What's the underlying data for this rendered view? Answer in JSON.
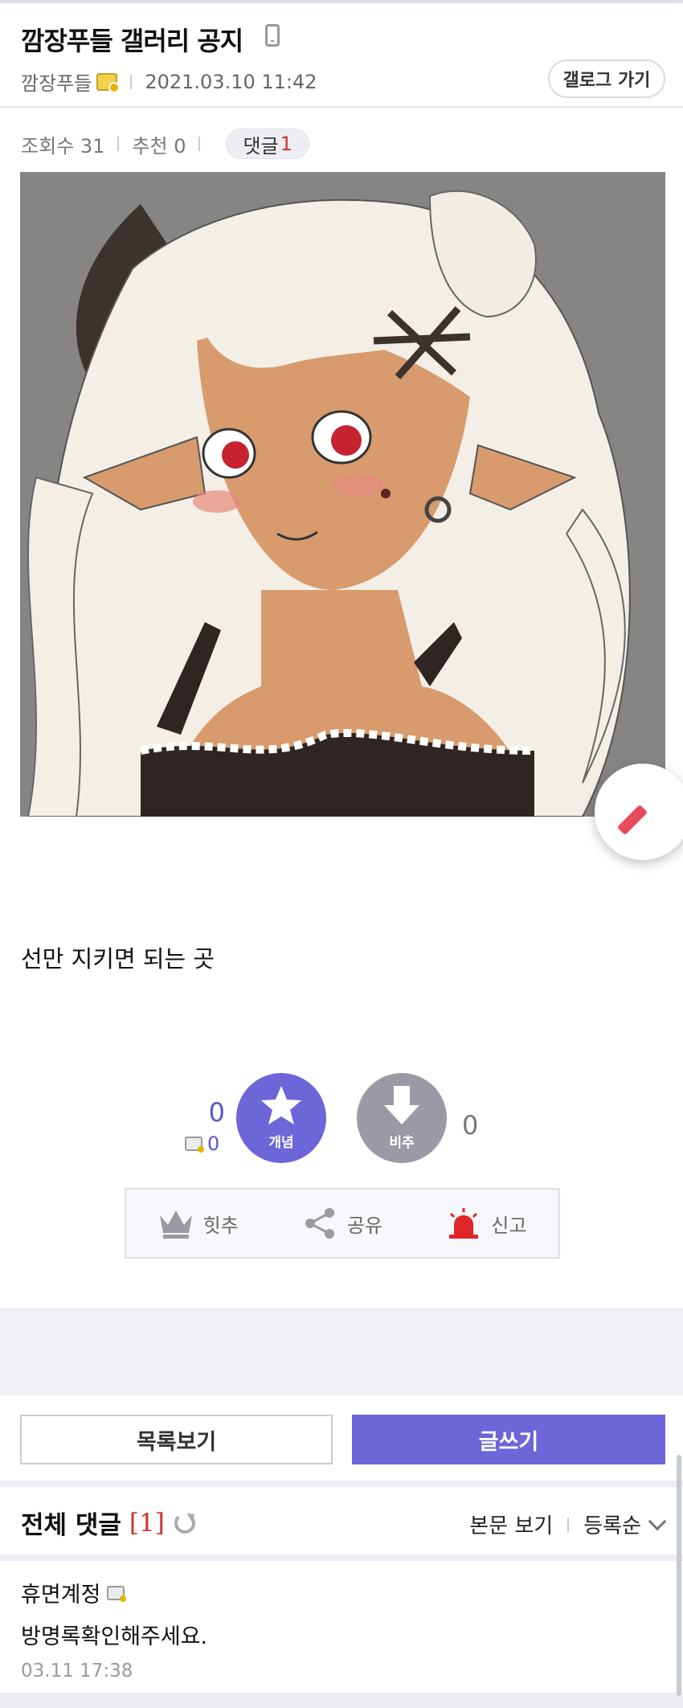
{
  "post": {
    "title": "깜장푸들 갤러리 공지",
    "author": "깜장푸들",
    "date": "2021.03.10 11:42",
    "gallog_button": "갤로그 가기"
  },
  "stats": {
    "views_label": "조회수 31",
    "recommend_label": "추천 0",
    "replies_label": "댓글",
    "replies_count": "1"
  },
  "content": {
    "text": "선만 지키면 되는 곳"
  },
  "vote": {
    "up_count": "0",
    "up_fixed_count": "0",
    "up_label": "개념",
    "down_label": "비추",
    "down_count": "0"
  },
  "actions": {
    "hit": "힛추",
    "share": "공유",
    "report": "신고"
  },
  "buttons": {
    "list": "목록보기",
    "write": "글쓰기"
  },
  "comments": {
    "title": "전체 댓글",
    "count": "[1]",
    "view_body": "본문 보기",
    "sort": "등록순",
    "items": [
      {
        "author": "휴면계정",
        "text": "방명록확인해주세요.",
        "time": "03.11 17:38"
      }
    ]
  },
  "colors": {
    "accent": "#6c66d9",
    "reply_count": "#d0312d",
    "report_icon": "#e0252b",
    "downvote": "#9a9aa4"
  }
}
